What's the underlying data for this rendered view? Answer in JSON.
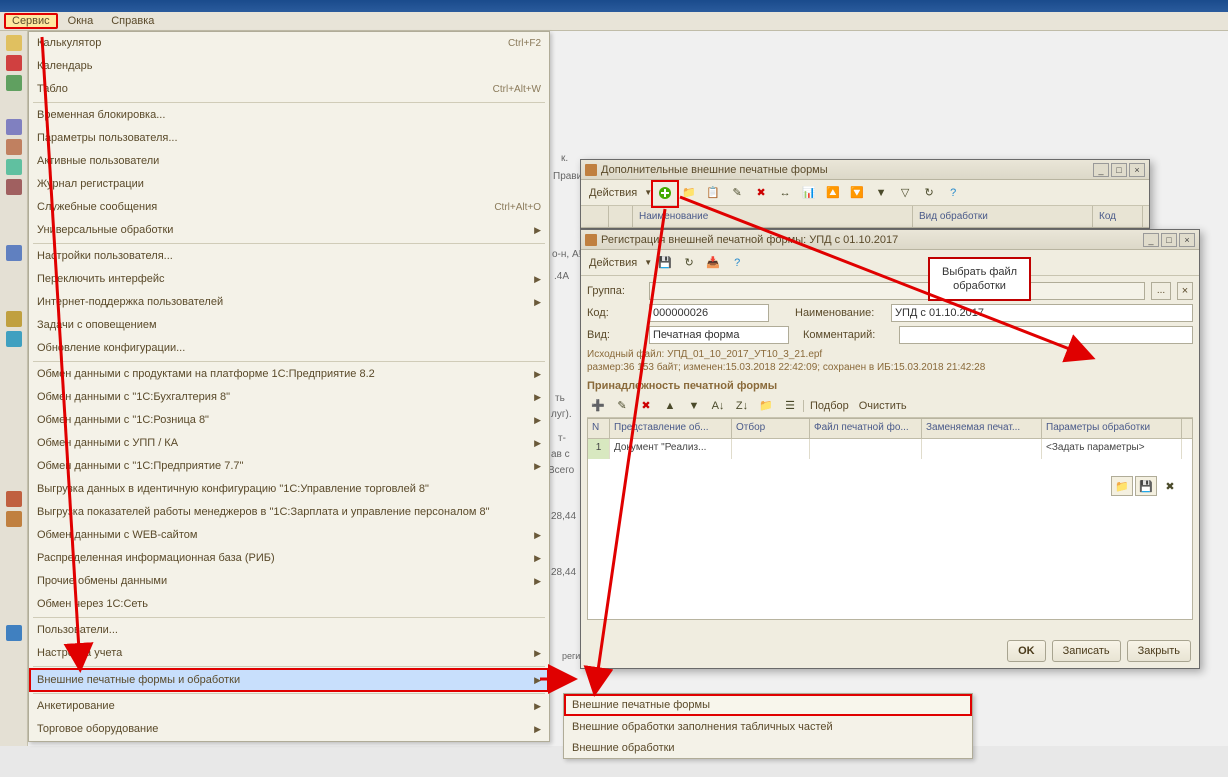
{
  "menubar": {
    "items": [
      "Сервис",
      "Окна",
      "Справка"
    ]
  },
  "dropdown": {
    "items": [
      {
        "label": "Калькулятор",
        "shortcut": "Ctrl+F2",
        "submenu": false
      },
      {
        "label": "Календарь",
        "submenu": false
      },
      {
        "label": "Табло",
        "shortcut": "Ctrl+Alt+W",
        "submenu": false
      },
      {
        "sep": true
      },
      {
        "label": "Временная блокировка...",
        "submenu": false
      },
      {
        "label": "Параметры пользователя...",
        "submenu": false
      },
      {
        "label": "Активные пользователи",
        "submenu": false
      },
      {
        "label": "Журнал регистрации",
        "submenu": false
      },
      {
        "label": "Служебные сообщения",
        "shortcut": "Ctrl+Alt+O",
        "submenu": false
      },
      {
        "label": "Универсальные обработки",
        "submenu": true
      },
      {
        "sep": true
      },
      {
        "label": "Настройки пользователя...",
        "submenu": false
      },
      {
        "label": "Переключить интерфейс",
        "submenu": true
      },
      {
        "label": "Интернет-поддержка пользователей",
        "submenu": true
      },
      {
        "label": "Задачи с оповещением",
        "submenu": false
      },
      {
        "label": "Обновление конфигурации...",
        "submenu": false
      },
      {
        "sep": true
      },
      {
        "label": "Обмен данными с продуктами на платформе 1С:Предприятие 8.2",
        "submenu": true
      },
      {
        "label": "Обмен данными с \"1С:Бухгалтерия 8\"",
        "submenu": true
      },
      {
        "label": "Обмен данными с \"1С:Розница 8\"",
        "submenu": true
      },
      {
        "label": "Обмен данными с УПП / КА",
        "submenu": true
      },
      {
        "label": "Обмен данными с \"1С:Предприятие 7.7\"",
        "submenu": true
      },
      {
        "label": "Выгрузка данных в идентичную конфигурацию \"1С:Управление торговлей 8\"",
        "submenu": false
      },
      {
        "label": "Выгрузка показателей работы менеджеров в \"1С:Зарплата и управление персоналом 8\"",
        "submenu": false
      },
      {
        "label": "Обмен данными с WEB-сайтом",
        "submenu": true
      },
      {
        "label": "Распределенная информационная база (РИБ)",
        "submenu": true
      },
      {
        "label": "Прочие обмены данными",
        "submenu": true
      },
      {
        "label": "Обмен через 1С:Сеть",
        "submenu": false
      },
      {
        "sep": true
      },
      {
        "label": "Пользователи...",
        "submenu": false
      },
      {
        "label": "Настройка учета",
        "submenu": true
      },
      {
        "sep": true
      },
      {
        "label": "Внешние печатные формы и обработки",
        "submenu": true,
        "highlighted": true
      },
      {
        "sep": true
      },
      {
        "label": "Анкетирование",
        "submenu": true
      },
      {
        "label": "Торговое оборудование",
        "submenu": true
      }
    ]
  },
  "submenu": {
    "items": [
      {
        "label": "Внешние печатные формы",
        "highlighted": true
      },
      {
        "label": "Внешние обработки заполнения табличных частей"
      },
      {
        "label": "Внешние обработки"
      }
    ]
  },
  "window1": {
    "title": "Дополнительные внешние печатные формы",
    "actions_label": "Действия",
    "headers": [
      "",
      "",
      "Наименование",
      "Вид обработки",
      "Код"
    ]
  },
  "window2": {
    "title": "Регистрация внешней печатной формы: УПД с 01.10.2017",
    "actions_label": "Действия",
    "group_label": "Группа:",
    "code_label": "Код:",
    "code_value": "000000026",
    "name_label": "Наименование:",
    "name_value": "УПД с 01.10.2017",
    "kind_label": "Вид:",
    "kind_value": "Печатная форма",
    "comment_label": "Комментарий:",
    "file_line1": "Исходный файл: УПД_01_10_2017_УТ10_3_21.epf",
    "file_line2": "размер:36 153 байт; изменен:15.03.2018 22:42:09; сохранен в ИБ:15.03.2018 21:42:28",
    "section_header": "Принадлежность печатной формы",
    "tb_select": "Подбор",
    "tb_clear": "Очистить",
    "table_headers": [
      "N",
      "Представление об...",
      "Отбор",
      "Файл печатной фо...",
      "Заменяемая печат...",
      "Параметры обработки"
    ],
    "table_row": {
      "n": "1",
      "repr": "Документ \"Реализ...",
      "params": "<Задать параметры>"
    },
    "btn_ok": "OK",
    "btn_save": "Записать",
    "btn_close": "Закрыть"
  },
  "callout": {
    "line1": "Выбрать файл",
    "line2": "обработки"
  },
  "bg": {
    "t1": "к.",
    "t2": "Правите.",
    "t3": "о-н, А!",
    "t4": ".4A",
    "t5": "ть",
    "t6": "луг).",
    "t7": "т-",
    "t8": "ав с",
    "t9": "Всего",
    "t10": "28,44",
    "t11": "28,44",
    "t12": "регистрации индивидуального предпринимателя)"
  }
}
